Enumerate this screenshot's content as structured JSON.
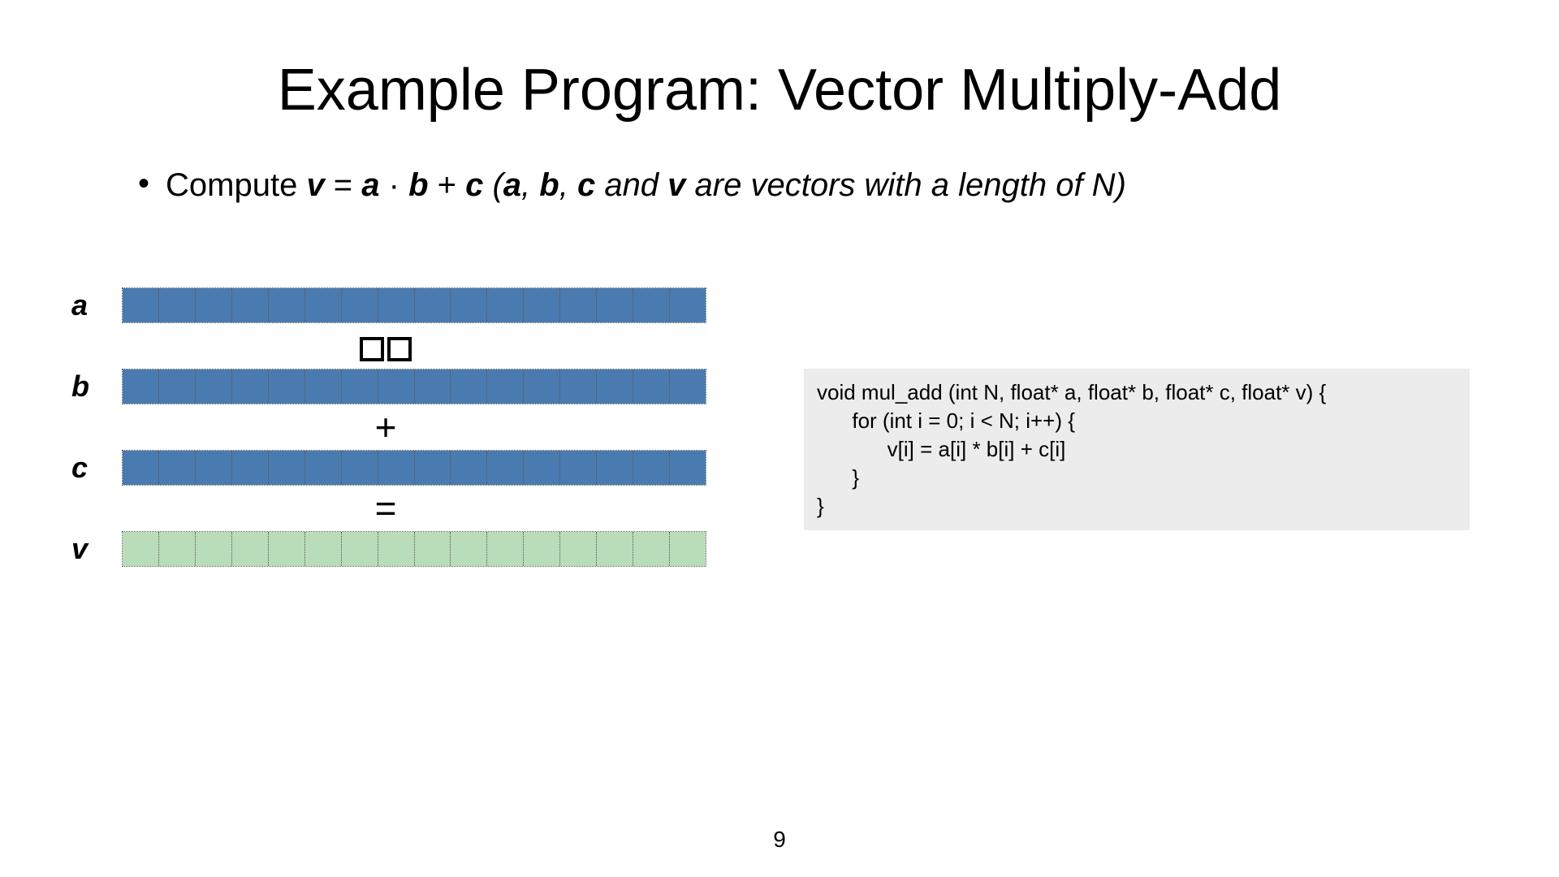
{
  "title": "Example Program: Vector Multiply-Add",
  "bullet": {
    "lead": "Compute ",
    "eq_v": "v",
    "eq_eq": " = ",
    "eq_a": "a",
    "eq_dot": " · ",
    "eq_b": "b",
    "eq_plus": " + ",
    "eq_c": "c",
    "paren_open": " (",
    "pa": "a",
    "comma1": ", ",
    "pb": "b",
    "comma2": ", ",
    "pc": "c",
    "and": " and ",
    "pv": "v",
    "rest": " are vectors with a length of N)"
  },
  "vectors": {
    "a": "a",
    "b": "b",
    "c": "c",
    "v": "v",
    "op_plus": "+",
    "op_eq": "="
  },
  "code": {
    "l1": "void mul_add (int N, float* a, float* b, float* c, float* v) {",
    "l2": "      for (int i = 0; i < N; i++) {",
    "l3": "            v[i] = a[i] * b[i] + c[i]",
    "l4": "      }",
    "l5": "}"
  },
  "page": "9",
  "cells": 16
}
